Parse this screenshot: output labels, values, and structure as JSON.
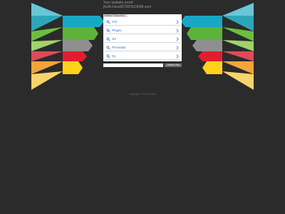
{
  "header": {
    "line1": "Your website proof:",
    "line2": "jhclth.htsul267i6f7k23f9t8.com"
  },
  "related": {
    "label": "Related Searches:"
  },
  "results": [
    {
      "label": "JTZ"
    },
    {
      "label": "Pmges"
    },
    {
      "label": "JIX"
    },
    {
      "label": "Prmoedus"
    },
    {
      "label": "Hy"
    }
  ],
  "search": {
    "placeholder": "",
    "button_label": "Search Ads"
  },
  "footer": {
    "copyright": "Copyright ©     Privacy Policy"
  },
  "colors": {
    "background": "#2b2b2b",
    "link": "#2a6cc3",
    "stripes": [
      "#4fb8c9",
      "#2fa6b8",
      "#6cbf3e",
      "#9a9a9a",
      "#d7323d",
      "#f4a43a",
      "#f8d31f"
    ]
  }
}
